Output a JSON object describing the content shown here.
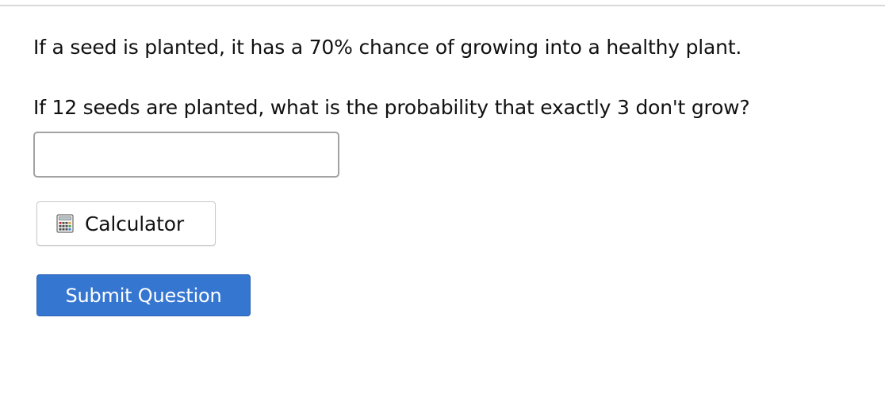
{
  "question": {
    "line1": "If a seed is planted, it has a 70% chance of growing into a healthy plant.",
    "line2": "If 12 seeds are planted, what is the probability that exactly 3 don't grow?"
  },
  "answer": {
    "value": "",
    "placeholder": ""
  },
  "calculator": {
    "label": "Calculator",
    "icon": "calculator-icon"
  },
  "submit": {
    "label": "Submit Question"
  },
  "colors": {
    "submit_background": "#3576d1",
    "submit_text": "#ffffff",
    "input_border": "#a3a3a3",
    "divider": "#d9d9d9"
  }
}
